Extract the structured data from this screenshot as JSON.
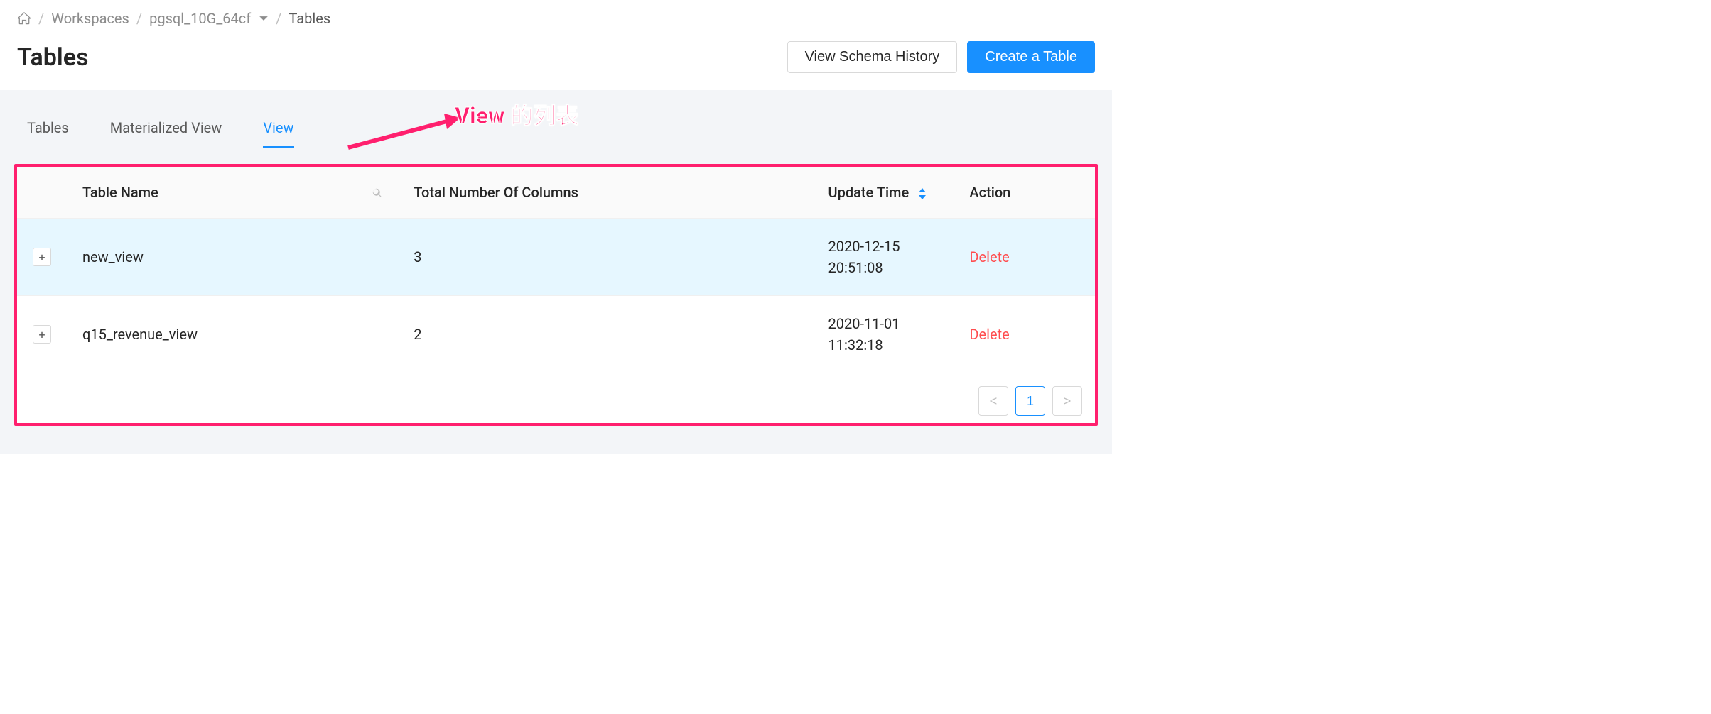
{
  "breadcrumb": {
    "workspaces": "Workspaces",
    "workspace_name": "pgsql_10G_64cf",
    "current": "Tables"
  },
  "header": {
    "title": "Tables",
    "view_schema_history": "View Schema History",
    "create_table": "Create a Table"
  },
  "tabs": {
    "tables": "Tables",
    "materialized_view": "Materialized View",
    "view": "View"
  },
  "annotation": "View 的列表",
  "table": {
    "columns": {
      "table_name": "Table Name",
      "total_columns": "Total Number Of Columns",
      "update_time": "Update Time",
      "action": "Action"
    },
    "rows": [
      {
        "name": "new_view",
        "cols": "3",
        "time_date": "2020-12-15",
        "time_clock": "20:51:08",
        "action": "Delete"
      },
      {
        "name": "q15_revenue_view",
        "cols": "2",
        "time_date": "2020-11-01",
        "time_clock": "11:32:18",
        "action": "Delete"
      }
    ]
  },
  "pagination": {
    "current": "1"
  }
}
